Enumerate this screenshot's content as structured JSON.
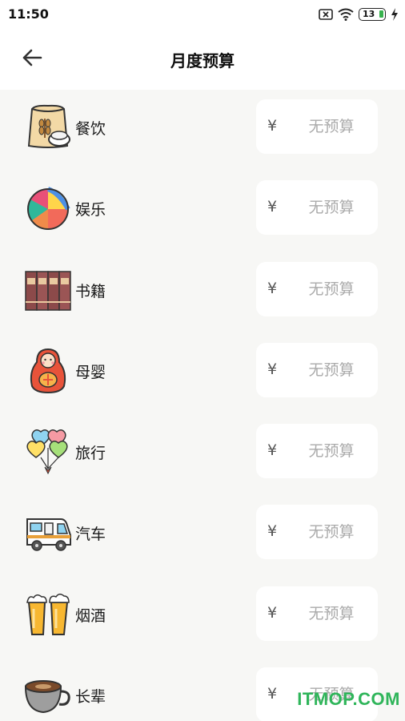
{
  "status_bar": {
    "time": "11:50",
    "battery": "13",
    "icons": [
      "notification-x-icon",
      "wifi-icon",
      "battery-icon",
      "charging-icon"
    ]
  },
  "header": {
    "title": "月度预算",
    "back_icon": "back-arrow-icon"
  },
  "currency_symbol": "¥",
  "categories": [
    {
      "label": "餐饮",
      "icon": "flour-sack-icon",
      "placeholder": "无预算"
    },
    {
      "label": "娱乐",
      "icon": "beach-ball-icon",
      "placeholder": "无预算"
    },
    {
      "label": "书籍",
      "icon": "books-icon",
      "placeholder": "无预算"
    },
    {
      "label": "母婴",
      "icon": "matryoshka-doll-icon",
      "placeholder": "无预算"
    },
    {
      "label": "旅行",
      "icon": "balloons-icon",
      "placeholder": "无预算"
    },
    {
      "label": "汽车",
      "icon": "camper-van-icon",
      "placeholder": "无预算"
    },
    {
      "label": "烟酒",
      "icon": "beer-mugs-icon",
      "placeholder": "无预算"
    },
    {
      "label": "长辈",
      "icon": "coffee-cup-icon",
      "placeholder": "无预算"
    }
  ],
  "watermark": "ITMOP.COM",
  "colors": {
    "background": "#f7f7f5",
    "card": "#ffffff",
    "placeholder": "#aaaaaa",
    "watermark": "#2fb55a"
  }
}
